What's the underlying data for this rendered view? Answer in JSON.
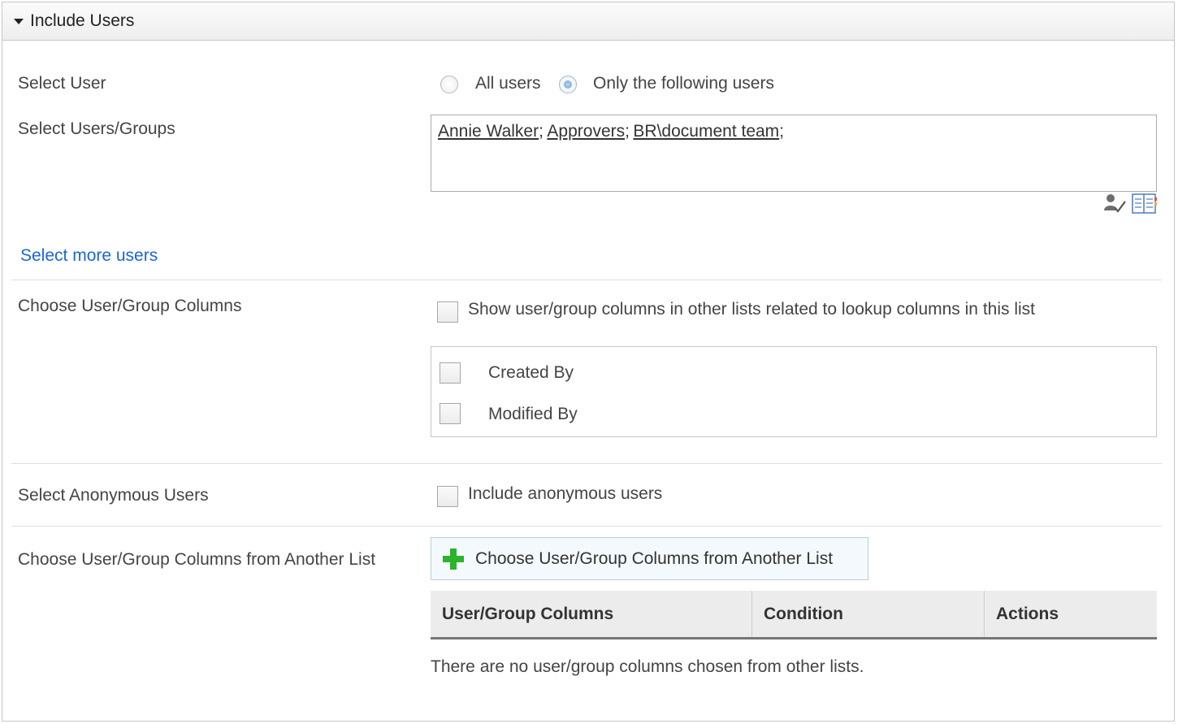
{
  "section": {
    "title": "Include Users",
    "collapse_icon": "triangle-down-icon"
  },
  "select_user": {
    "label": "Select User",
    "options": [
      {
        "label": "All users",
        "selected": false
      },
      {
        "label": "Only the following users",
        "selected": true
      }
    ]
  },
  "users_groups": {
    "label": "Select Users/Groups",
    "entries": [
      "Annie Walker",
      "Approvers",
      "BR\\document team"
    ],
    "separator": ";",
    "icons": [
      "check-names-icon",
      "browse-directory-icon"
    ]
  },
  "select_more": {
    "label": "Select more users"
  },
  "user_group_columns": {
    "label": "Choose User/Group Columns",
    "show_related_label": "Show user/group columns in other lists related to lookup columns in this list",
    "show_related_checked": false,
    "columns": [
      {
        "label": "Created By",
        "checked": false
      },
      {
        "label": "Modified By",
        "checked": false
      }
    ]
  },
  "anonymous": {
    "label": "Select Anonymous Users",
    "checkbox_label": "Include anonymous users",
    "checked": false
  },
  "another_list": {
    "label": "Choose User/Group Columns from Another List",
    "button_label": "Choose User/Group Columns from Another List",
    "button_icon": "plus-icon",
    "table_headers": [
      "User/Group Columns",
      "Condition",
      "Actions"
    ],
    "empty_message": "There are no user/group columns chosen from other lists."
  },
  "colors": {
    "link": "#1a66d9",
    "plus_icon": "#2db32d",
    "header_bg": "#eeeeee"
  }
}
